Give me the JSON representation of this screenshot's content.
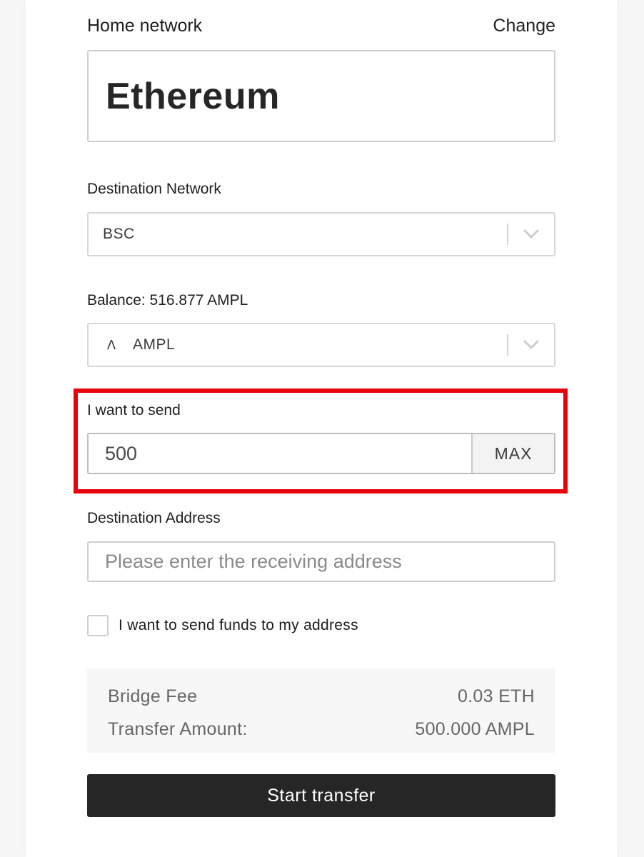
{
  "home_network": {
    "label": "Home network",
    "change_label": "Change",
    "value": "Ethereum"
  },
  "destination_network": {
    "label": "Destination Network",
    "selected": "BSC"
  },
  "token": {
    "balance_label": "Balance: 516.877 AMPL",
    "icon_glyph": "Λ",
    "selected": "AMPL"
  },
  "amount": {
    "label": "I want to send",
    "value": "500",
    "max_label": "MAX"
  },
  "destination_address": {
    "label": "Destination Address",
    "placeholder": "Please enter the receiving address",
    "value": ""
  },
  "send_to_self": {
    "label": "I want to send funds to my address",
    "checked": false
  },
  "summary": {
    "bridge_fee_label": "Bridge Fee",
    "bridge_fee_value": "0.03 ETH",
    "transfer_amount_label": "Transfer Amount:",
    "transfer_amount_value": "500.000 AMPL"
  },
  "start_button_label": "Start transfer",
  "colors": {
    "highlight": "#e8000b",
    "button_bg": "#262626",
    "summary_bg": "#f7f7f7"
  }
}
